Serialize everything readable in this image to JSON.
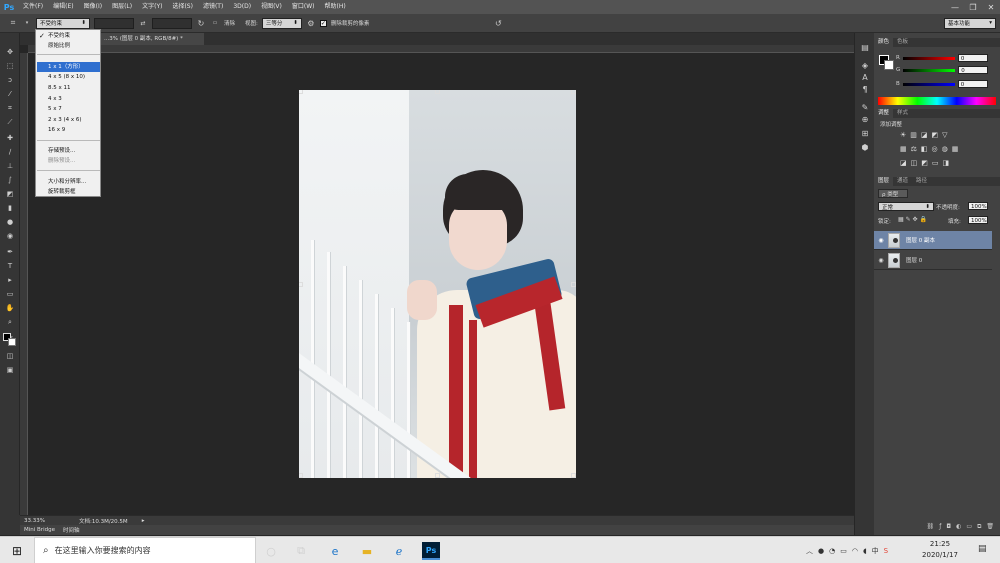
{
  "app": {
    "logo": "Ps",
    "brand_color": "#31a8ff"
  },
  "menu": [
    "文件(F)",
    "编辑(E)",
    "图像(I)",
    "图层(L)",
    "文字(Y)",
    "选择(S)",
    "滤镜(T)",
    "3D(D)",
    "视图(V)",
    "窗口(W)",
    "帮助(H)"
  ],
  "window_controls": {
    "minimize": "—",
    "maximize": "❐",
    "close": "✕"
  },
  "options": {
    "ratio_value": "不受约束",
    "clear_label": "清除",
    "view_label": "视图:",
    "view_value": "三等分",
    "delete_cropped_label": "删除裁剪的像素",
    "workspace": "基本功能"
  },
  "document": {
    "tab_title": "...3% (图层 0 副本, RGB/8#) *",
    "zoom": "33.33%",
    "doc_size": "文档:10.3M/20.5M"
  },
  "bottom_tabs": [
    "Mini Bridge",
    "时间轴"
  ],
  "ratio_menu": {
    "items_top": [
      "不受约束",
      "原始比例"
    ],
    "items_ratio": [
      "1 x 1（方形）",
      "4 x 5 (8 x 10)",
      "8.5 x 11",
      "4 x 3",
      "5 x 7",
      "2 x 3 (4 x 6)",
      "16 x 9"
    ],
    "items_preset": [
      "存储预设...",
      "删除预设..."
    ],
    "items_bottom": [
      "大小和分辨率...",
      "旋转裁剪框"
    ]
  },
  "panels": {
    "color_tabs": [
      "颜色",
      "色板"
    ],
    "rgb": [
      {
        "label": "R",
        "value": "0"
      },
      {
        "label": "G",
        "value": "0"
      },
      {
        "label": "B",
        "value": "0"
      }
    ],
    "adjust_tabs": [
      "调整",
      "样式"
    ],
    "adjust_add": "添加调整",
    "layers_tabs": [
      "图层",
      "通道",
      "路径"
    ],
    "filter_type": "ρ 类型",
    "blend_mode": "正常",
    "opacity_label": "不透明度:",
    "opacity_value": "100%",
    "lock_label": "锁定:",
    "fill_label": "填充:",
    "fill_value": "100%",
    "layers": [
      {
        "name": "图层 0 副本",
        "active": true
      },
      {
        "name": "图层 0",
        "active": false
      }
    ]
  },
  "taskbar": {
    "search_placeholder": "在这里输入你要搜索的内容",
    "time": "21:25",
    "date": "2020/1/17",
    "ime": "中"
  }
}
